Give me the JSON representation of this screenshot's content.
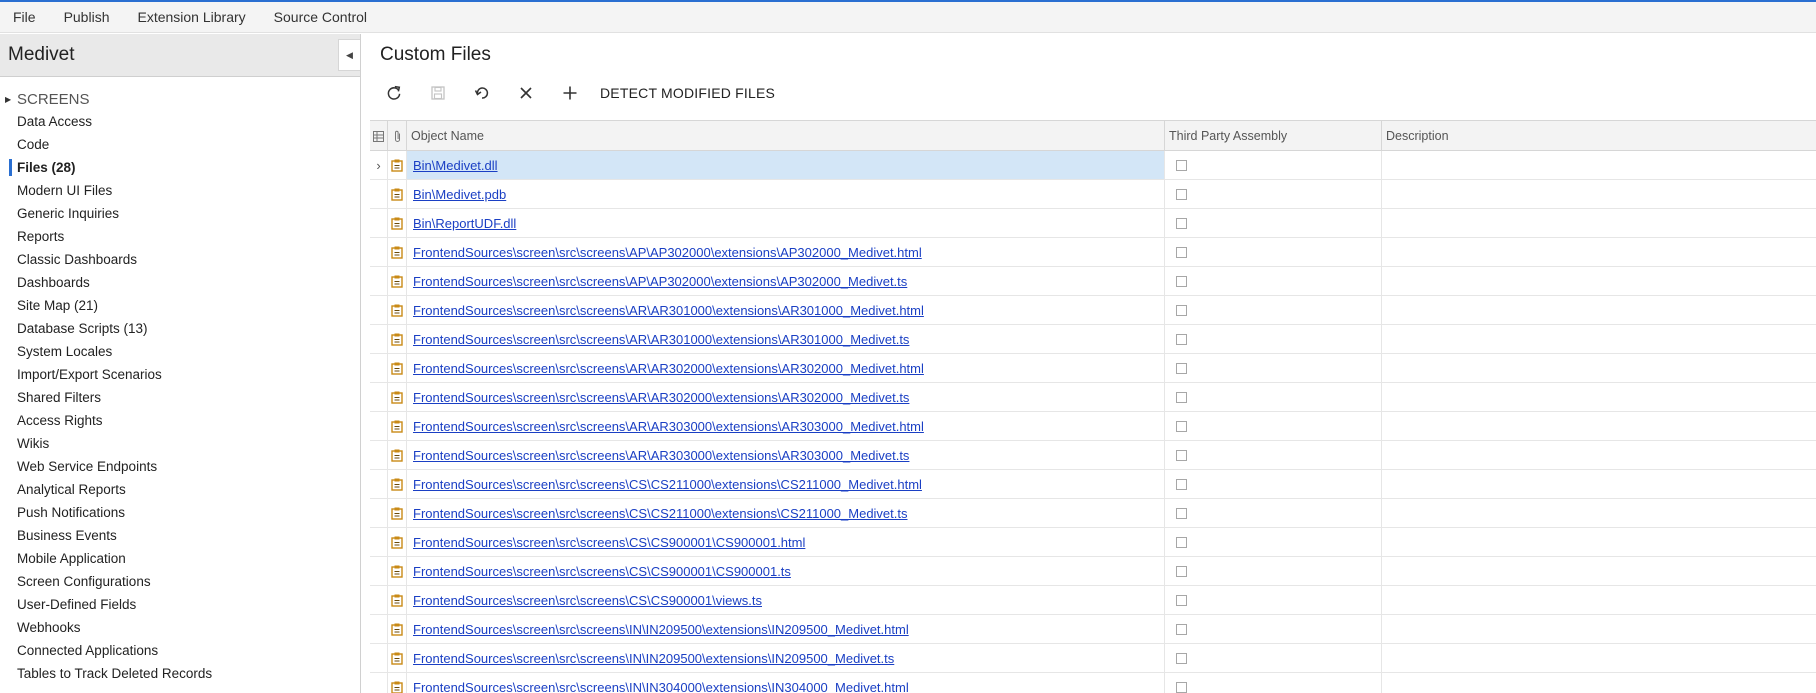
{
  "menu": [
    "File",
    "Publish",
    "Extension Library",
    "Source Control"
  ],
  "sidebar": {
    "title": "Medivet",
    "root": "SCREENS",
    "items": [
      {
        "label": "Data Access",
        "active": false
      },
      {
        "label": "Code",
        "active": false
      },
      {
        "label": "Files (28)",
        "active": true
      },
      {
        "label": "Modern UI Files",
        "active": false
      },
      {
        "label": "Generic Inquiries",
        "active": false
      },
      {
        "label": "Reports",
        "active": false
      },
      {
        "label": "Classic Dashboards",
        "active": false
      },
      {
        "label": "Dashboards",
        "active": false
      },
      {
        "label": "Site Map (21)",
        "active": false
      },
      {
        "label": "Database Scripts (13)",
        "active": false
      },
      {
        "label": "System Locales",
        "active": false
      },
      {
        "label": "Import/Export Scenarios",
        "active": false
      },
      {
        "label": "Shared Filters",
        "active": false
      },
      {
        "label": "Access Rights",
        "active": false
      },
      {
        "label": "Wikis",
        "active": false
      },
      {
        "label": "Web Service Endpoints",
        "active": false
      },
      {
        "label": "Analytical Reports",
        "active": false
      },
      {
        "label": "Push Notifications",
        "active": false
      },
      {
        "label": "Business Events",
        "active": false
      },
      {
        "label": "Mobile Application",
        "active": false
      },
      {
        "label": "Screen Configurations",
        "active": false
      },
      {
        "label": "User-Defined Fields",
        "active": false
      },
      {
        "label": "Webhooks",
        "active": false
      },
      {
        "label": "Connected Applications",
        "active": false
      },
      {
        "label": "Tables to Track Deleted Records",
        "active": false
      }
    ]
  },
  "page": {
    "title": "Custom Files",
    "toolbar": {
      "refresh_icon": "refresh-icon",
      "save_icon": "save-icon",
      "undo_icon": "undo-icon",
      "delete_icon": "close-icon",
      "add_icon": "plus-icon",
      "detect_label": "DETECT MODIFIED FILES"
    }
  },
  "grid": {
    "columns": {
      "object_name": "Object Name",
      "third_party": "Third Party Assembly",
      "description": "Description"
    },
    "rows": [
      {
        "name": "Bin\\Medivet.dll",
        "third_party": false,
        "description": "",
        "selected": true
      },
      {
        "name": "Bin\\Medivet.pdb",
        "third_party": false,
        "description": "",
        "selected": false
      },
      {
        "name": "Bin\\ReportUDF.dll",
        "third_party": false,
        "description": "",
        "selected": false
      },
      {
        "name": "FrontendSources\\screen\\src\\screens\\AP\\AP302000\\extensions\\AP302000_Medivet.html",
        "third_party": false,
        "description": "",
        "selected": false
      },
      {
        "name": "FrontendSources\\screen\\src\\screens\\AP\\AP302000\\extensions\\AP302000_Medivet.ts",
        "third_party": false,
        "description": "",
        "selected": false
      },
      {
        "name": "FrontendSources\\screen\\src\\screens\\AR\\AR301000\\extensions\\AR301000_Medivet.html",
        "third_party": false,
        "description": "",
        "selected": false
      },
      {
        "name": "FrontendSources\\screen\\src\\screens\\AR\\AR301000\\extensions\\AR301000_Medivet.ts",
        "third_party": false,
        "description": "",
        "selected": false
      },
      {
        "name": "FrontendSources\\screen\\src\\screens\\AR\\AR302000\\extensions\\AR302000_Medivet.html",
        "third_party": false,
        "description": "",
        "selected": false
      },
      {
        "name": "FrontendSources\\screen\\src\\screens\\AR\\AR302000\\extensions\\AR302000_Medivet.ts",
        "third_party": false,
        "description": "",
        "selected": false
      },
      {
        "name": "FrontendSources\\screen\\src\\screens\\AR\\AR303000\\extensions\\AR303000_Medivet.html",
        "third_party": false,
        "description": "",
        "selected": false
      },
      {
        "name": "FrontendSources\\screen\\src\\screens\\AR\\AR303000\\extensions\\AR303000_Medivet.ts",
        "third_party": false,
        "description": "",
        "selected": false
      },
      {
        "name": "FrontendSources\\screen\\src\\screens\\CS\\CS211000\\extensions\\CS211000_Medivet.html",
        "third_party": false,
        "description": "",
        "selected": false
      },
      {
        "name": "FrontendSources\\screen\\src\\screens\\CS\\CS211000\\extensions\\CS211000_Medivet.ts",
        "third_party": false,
        "description": "",
        "selected": false
      },
      {
        "name": "FrontendSources\\screen\\src\\screens\\CS\\CS900001\\CS900001.html",
        "third_party": false,
        "description": "",
        "selected": false
      },
      {
        "name": "FrontendSources\\screen\\src\\screens\\CS\\CS900001\\CS900001.ts",
        "third_party": false,
        "description": "",
        "selected": false
      },
      {
        "name": "FrontendSources\\screen\\src\\screens\\CS\\CS900001\\views.ts",
        "third_party": false,
        "description": "",
        "selected": false
      },
      {
        "name": "FrontendSources\\screen\\src\\screens\\IN\\IN209500\\extensions\\IN209500_Medivet.html",
        "third_party": false,
        "description": "",
        "selected": false
      },
      {
        "name": "FrontendSources\\screen\\src\\screens\\IN\\IN209500\\extensions\\IN209500_Medivet.ts",
        "third_party": false,
        "description": "",
        "selected": false
      },
      {
        "name": "FrontendSources\\screen\\src\\screens\\IN\\IN304000\\extensions\\IN304000_Medivet.html",
        "third_party": false,
        "description": "",
        "selected": false
      }
    ]
  },
  "colors": {
    "accent": "#2a6fd1",
    "link": "#1a3fc4",
    "selected_row": "#d3e6f7",
    "file_icon": "#c98a16"
  }
}
